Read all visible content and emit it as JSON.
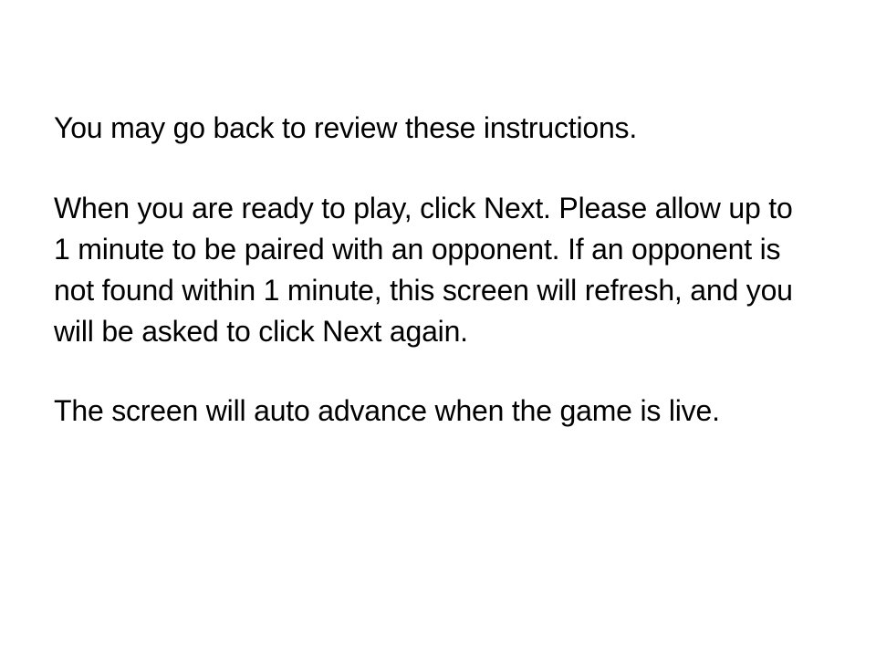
{
  "slide": {
    "paragraphs": [
      "You may go back to review these instructions.",
      "When you are ready to play, click Next. Please allow up to 1 minute to be paired with an opponent. If an opponent is not found within 1 minute, this screen will refresh, and you will be asked to click Next again.",
      "The screen will auto advance when the game is live."
    ]
  }
}
